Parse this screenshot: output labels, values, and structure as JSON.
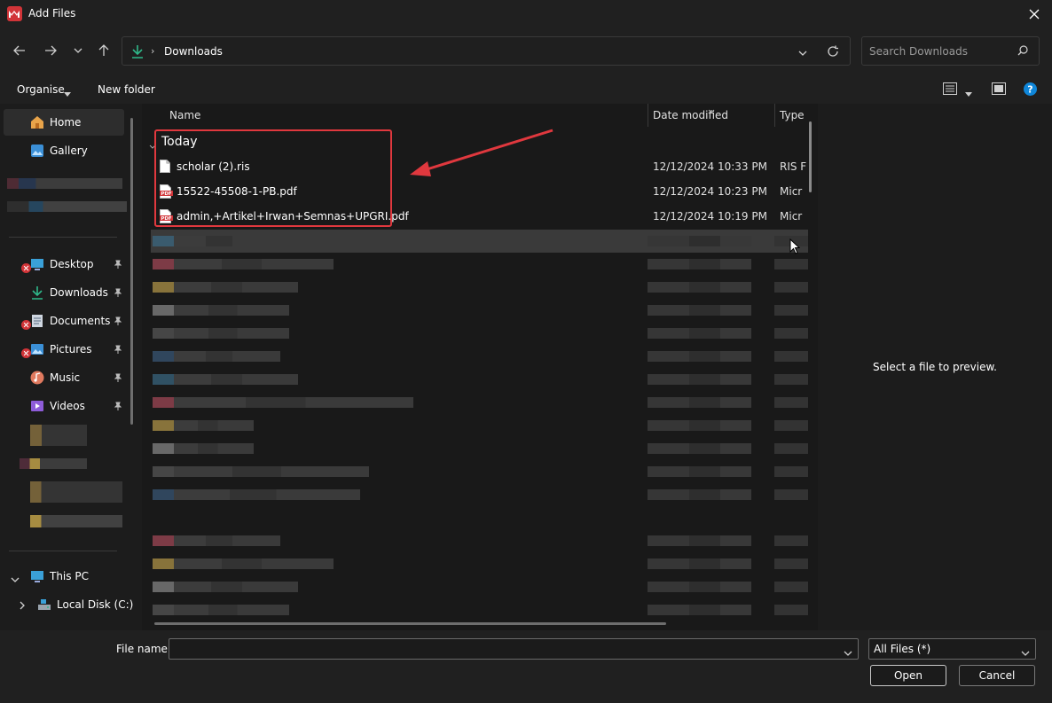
{
  "window": {
    "title": "Add Files"
  },
  "address": {
    "crumb": "Downloads"
  },
  "search": {
    "placeholder": "Search Downloads"
  },
  "commands": {
    "organise": "Organise",
    "new_folder": "New folder"
  },
  "sidebar": {
    "home": "Home",
    "gallery": "Gallery",
    "desktop": "Desktop",
    "downloads": "Downloads",
    "documents": "Documents",
    "pictures": "Pictures",
    "music": "Music",
    "videos": "Videos",
    "this_pc": "This PC",
    "local_disk": "Local Disk (C:)"
  },
  "columns": {
    "name": "Name",
    "date": "Date modified",
    "type": "Type"
  },
  "group": {
    "title": "Today"
  },
  "files": [
    {
      "name": "scholar (2).ris",
      "date": "12/12/2024 10:33 PM",
      "type": "RIS F",
      "icon": "document-icon"
    },
    {
      "name": "15522-45508-1-PB.pdf",
      "date": "12/12/2024 10:23 PM",
      "type": "Micr",
      "icon": "pdf-icon"
    },
    {
      "name": "admin,+Artikel+Irwan+Semnas+UPGRI.pdf",
      "date": "12/12/2024 10:19 PM",
      "type": "Micr",
      "icon": "pdf-icon"
    }
  ],
  "preview": {
    "message": "Select a file to preview."
  },
  "footer": {
    "file_name_label": "File name:",
    "file_name_value": "",
    "file_type": "All Files  (*)",
    "open": "Open",
    "cancel": "Cancel"
  },
  "colors": {
    "highlight": "#e0383e",
    "accent": "#0f86d9"
  }
}
